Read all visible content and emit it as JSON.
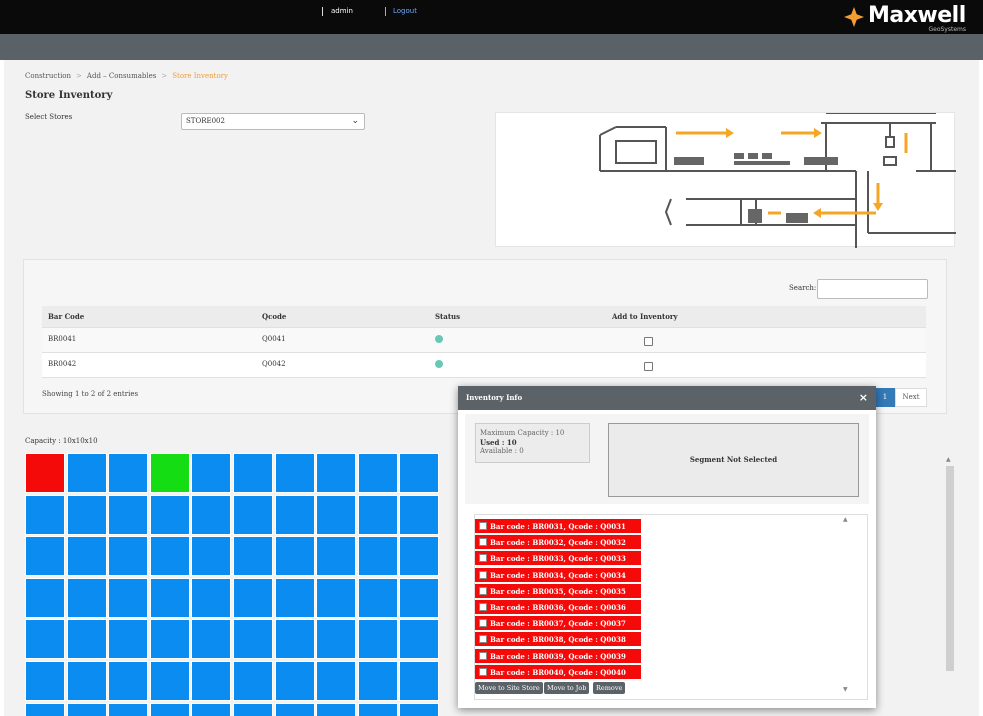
{
  "topbar": {
    "user": "admin",
    "logout": "Logout"
  },
  "brand": {
    "name": "Maxwell",
    "sub": "GeoSystems",
    "accent": "#f39c34"
  },
  "breadcrumb": [
    "Construction",
    "Add – Consumables",
    "Store Inventory"
  ],
  "page_title": "Store Inventory",
  "store": {
    "label": "Select Stores",
    "value": "STORE002"
  },
  "search": {
    "label": "Search:",
    "value": ""
  },
  "table": {
    "headers": [
      "Bar Code",
      "Qcode",
      "Status",
      "Add to Inventory"
    ],
    "rows": [
      {
        "bar_code": "BR0041",
        "qcode": "Q0041",
        "status_color": "#66c9b6",
        "checked": false
      },
      {
        "bar_code": "BR0042",
        "qcode": "Q0042",
        "status_color": "#66c9b6",
        "checked": false
      }
    ],
    "entries_text": "Showing 1 to 2 of 2 entries"
  },
  "pagination": {
    "current": "1",
    "next": "Next"
  },
  "capacity": {
    "label": "Capacity : 10x10x10",
    "colors": {
      "empty": "#0b8cf0",
      "red": "#f50a0a",
      "green": "#14dd14"
    }
  },
  "modal": {
    "title": "Inventory Info",
    "close": "×",
    "max_capacity": "Maximum Capacity : 10",
    "used": "Used : 10",
    "available": "Available : 0",
    "segment": "Segment Not Selected",
    "items": [
      "Bar code : BR0031, Qcode : Q0031",
      "Bar code : BR0032, Qcode : Q0032",
      "Bar code : BR0033, Qcode : Q0033",
      "Bar code : BR0034, Qcode : Q0034",
      "Bar code : BR0035, Qcode : Q0035",
      "Bar code : BR0036, Qcode : Q0036",
      "Bar code : BR0037, Qcode : Q0037",
      "Bar code : BR0038, Qcode : Q0038",
      "Bar code : BR0039, Qcode : Q0039",
      "Bar code : BR0040, Qcode : Q0040"
    ],
    "buttons": [
      "Move to Site Store",
      "Move to Job",
      "Remove"
    ]
  }
}
